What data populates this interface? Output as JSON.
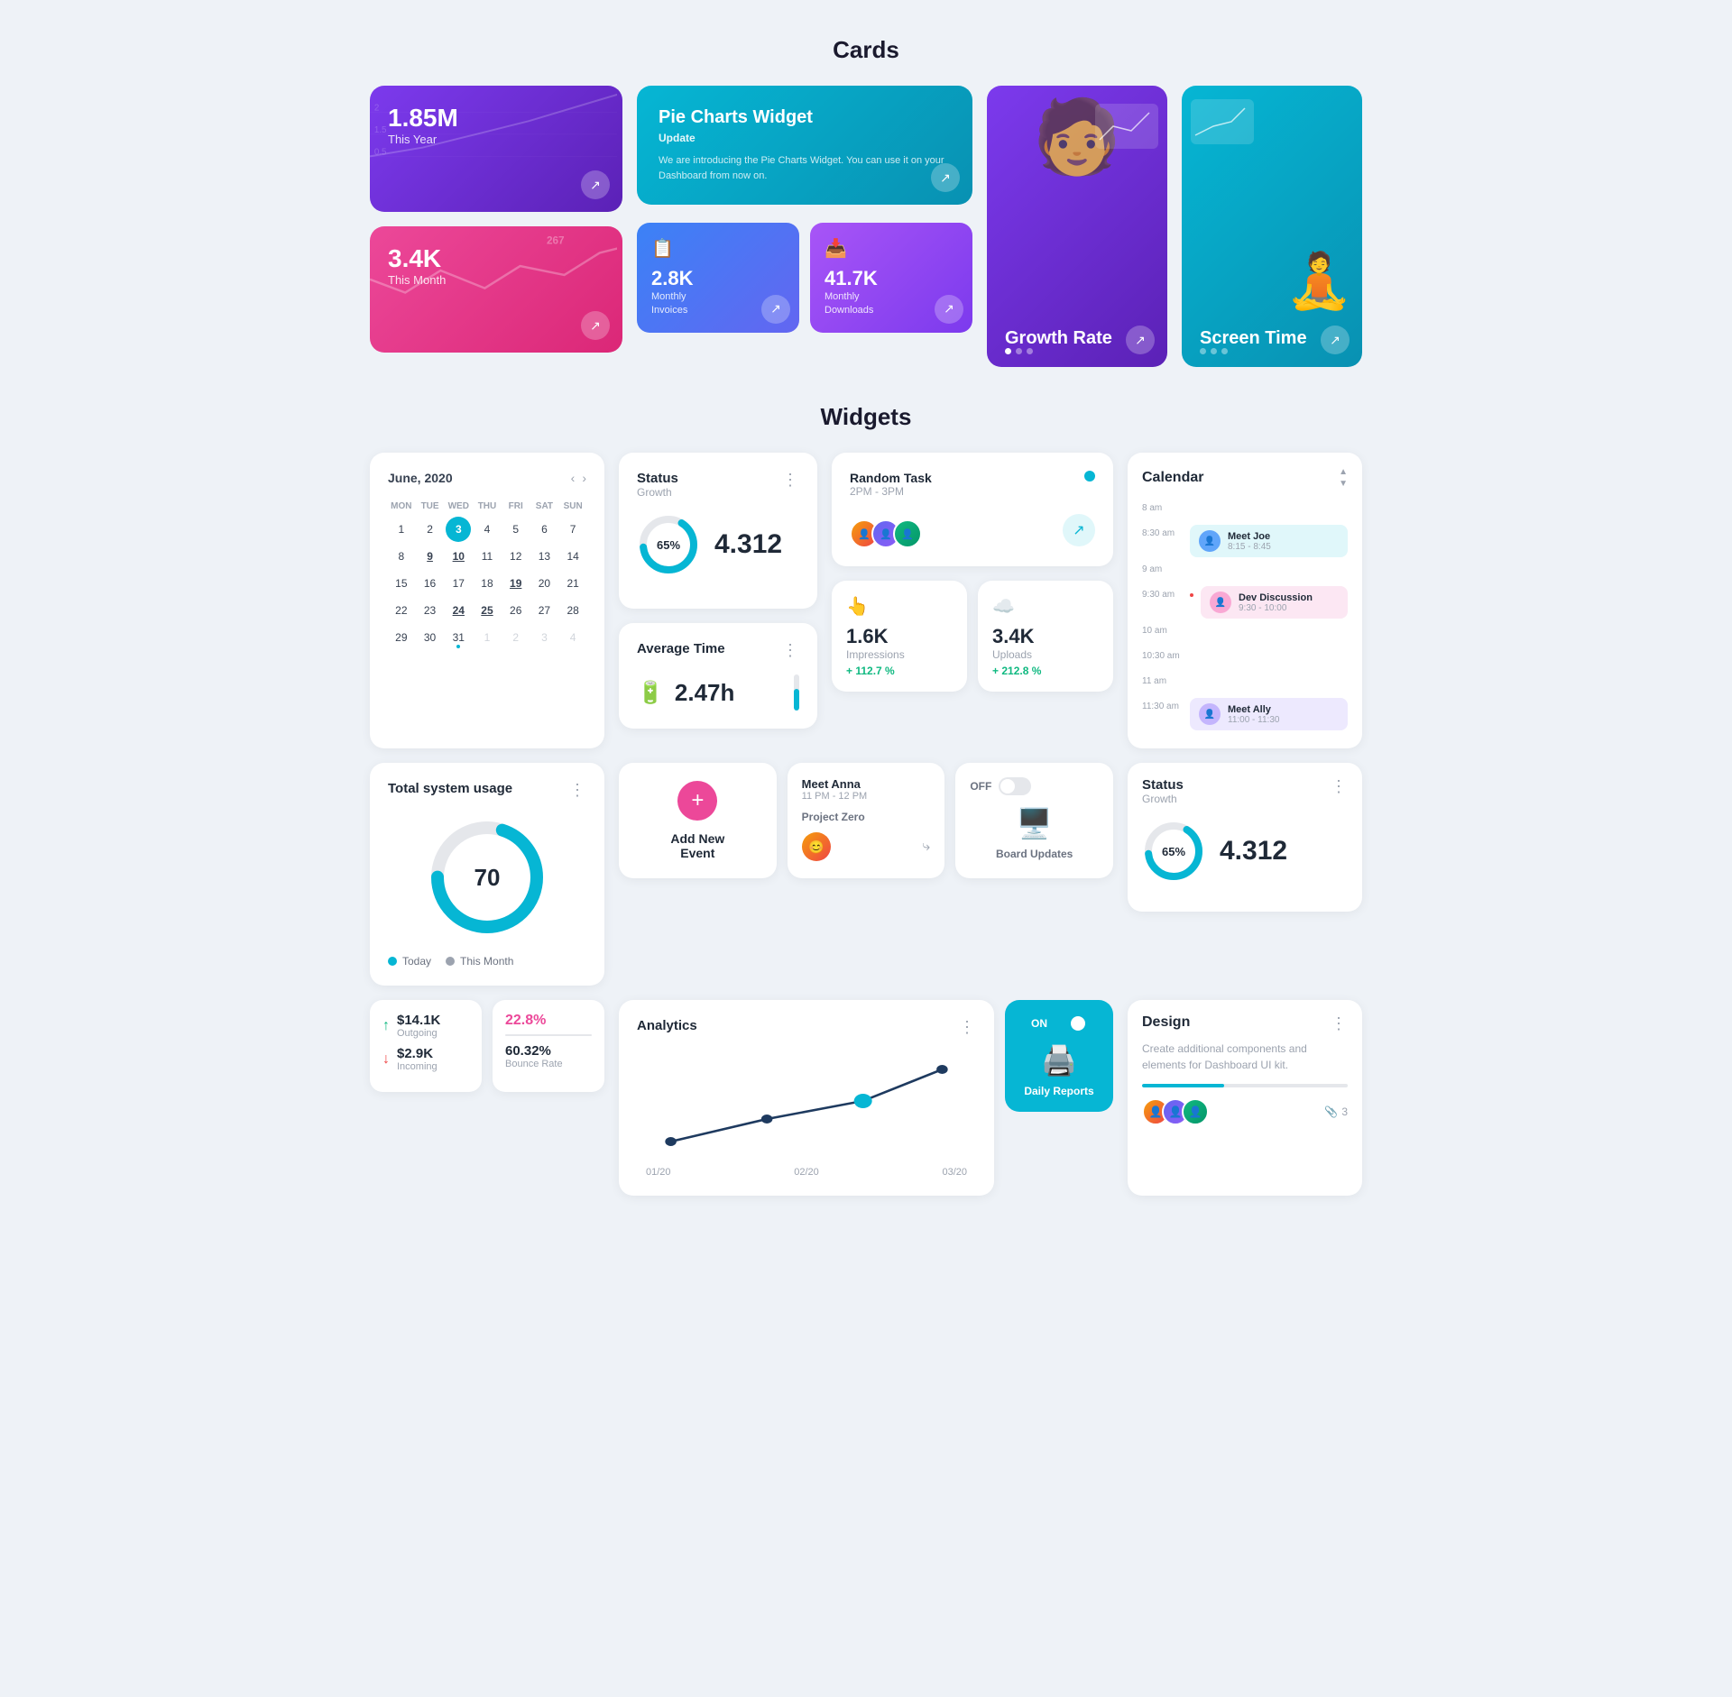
{
  "page": {
    "sections": {
      "cards_title": "Cards",
      "widgets_title": "Widgets"
    }
  },
  "cards": {
    "purple_card": {
      "value": "1.85M",
      "label": "This Year",
      "arrow": "↗"
    },
    "pink_card": {
      "value": "3.4K",
      "label": "This Month",
      "arrow": "↗"
    },
    "pie_widget": {
      "title": "Pie Charts Widget",
      "subtitle": "Update",
      "description": "We are introducing the Pie Charts Widget. You can use it on your Dashboard from now on.",
      "arrow": "↗"
    },
    "monthly_invoices": {
      "icon": "📋",
      "value": "2.8K",
      "label1": "Monthly",
      "label2": "Invoices",
      "arrow": "↗"
    },
    "monthly_downloads": {
      "icon": "📥",
      "value": "41.7K",
      "label1": "Monthly",
      "label2": "Downloads",
      "arrow": "↗"
    },
    "growth_rate": {
      "label": "Growth Rate",
      "dots": [
        "active",
        "",
        ""
      ],
      "arrow": "↗"
    },
    "screen_time": {
      "label": "Screen Time",
      "dots": [
        "",
        "",
        ""
      ],
      "arrow": "↗"
    }
  },
  "calendar_small": {
    "title": "June, 2020",
    "days_header": [
      "MON",
      "TUE",
      "WED",
      "THU",
      "FRI",
      "SAT",
      "SUN"
    ],
    "weeks": [
      [
        {
          "day": "1",
          "type": ""
        },
        {
          "day": "2",
          "type": ""
        },
        {
          "day": "3",
          "type": "today"
        },
        {
          "day": "4",
          "type": ""
        },
        {
          "day": "5",
          "type": ""
        },
        {
          "day": "6",
          "type": ""
        },
        {
          "day": "7",
          "type": ""
        }
      ],
      [
        {
          "day": "8",
          "type": ""
        },
        {
          "day": "9",
          "type": "underline"
        },
        {
          "day": "10",
          "type": "underline"
        },
        {
          "day": "11",
          "type": ""
        },
        {
          "day": "12",
          "type": ""
        },
        {
          "day": "13",
          "type": ""
        },
        {
          "day": "14",
          "type": ""
        }
      ],
      [
        {
          "day": "15",
          "type": ""
        },
        {
          "day": "16",
          "type": ""
        },
        {
          "day": "17",
          "type": ""
        },
        {
          "day": "18",
          "type": ""
        },
        {
          "day": "19",
          "type": "underline"
        },
        {
          "day": "20",
          "type": ""
        },
        {
          "day": "21",
          "type": ""
        }
      ],
      [
        {
          "day": "22",
          "type": ""
        },
        {
          "day": "23",
          "type": ""
        },
        {
          "day": "24",
          "type": "underline"
        },
        {
          "day": "25",
          "type": "underline"
        },
        {
          "day": "26",
          "type": ""
        },
        {
          "day": "27",
          "type": ""
        },
        {
          "day": "28",
          "type": ""
        }
      ],
      [
        {
          "day": "29",
          "type": ""
        },
        {
          "day": "30",
          "type": ""
        },
        {
          "day": "31",
          "type": "dot-mark"
        },
        {
          "day": "1",
          "type": "faded"
        },
        {
          "day": "2",
          "type": "faded"
        },
        {
          "day": "3",
          "type": "faded"
        },
        {
          "day": "4",
          "type": "faded"
        }
      ]
    ]
  },
  "status_widget": {
    "title": "Status",
    "subtitle": "Growth",
    "menu": "⋮",
    "percent": 65,
    "value": "4.312"
  },
  "avg_time_widget": {
    "title": "Average Time",
    "menu": "⋮",
    "value": "2.47h",
    "progress": 60
  },
  "random_task": {
    "title": "Random Task",
    "time": "2PM - 3PM",
    "status_dot": true,
    "avatars": [
      "👤",
      "👤",
      "👤"
    ],
    "arrow": "↗"
  },
  "impressions": {
    "icon": "👆",
    "value": "1.6K",
    "label": "Impressions",
    "change": "+ 112.7 %"
  },
  "uploads": {
    "icon": "☁️",
    "value": "3.4K",
    "label": "Uploads",
    "change": "+ 212.8 %"
  },
  "system_usage": {
    "title": "Total system usage",
    "menu": "⋮",
    "percent": 70,
    "legend": {
      "today": "Today",
      "this_month": "This Month"
    }
  },
  "add_event": {
    "plus": "+",
    "label1": "Add New",
    "label2": "Event"
  },
  "meet_anna": {
    "title": "Meet Anna",
    "time": "11 PM - 12 PM",
    "project": "Project Zero",
    "share_icon": "⟳"
  },
  "off_board": {
    "toggle_label": "OFF",
    "toggle_state": false,
    "icon": "🖥️",
    "label": "Board Updates"
  },
  "daily_reports": {
    "toggle_label": "ON",
    "toggle_state": true,
    "icon": "🖨️",
    "label": "Daily Reports"
  },
  "analytics": {
    "title": "Analytics",
    "menu": "⋮",
    "x_labels": [
      "01/20",
      "02/20",
      "03/20"
    ],
    "chart_points": [
      {
        "x": 10,
        "y": 80
      },
      {
        "x": 35,
        "y": 60
      },
      {
        "x": 60,
        "y": 50
      },
      {
        "x": 85,
        "y": 15
      }
    ]
  },
  "calendar_timeline": {
    "title": "Calendar",
    "events": [
      {
        "time": "8 am",
        "event": null
      },
      {
        "time": "8:30 am",
        "event": {
          "title": "Meet Joe",
          "time_range": "8:15 - 8:45",
          "color": "blue"
        }
      },
      {
        "time": "9 am",
        "event": null
      },
      {
        "time": "9:30 am",
        "event": {
          "title": "Dev Discussion",
          "time_range": "9:30 - 10:00",
          "color": "pink"
        },
        "indicator": true
      },
      {
        "time": "10 am",
        "event": null
      },
      {
        "time": "10:30 am",
        "event": null
      },
      {
        "time": "11 am",
        "event": null
      },
      {
        "time": "11:30 am",
        "event": {
          "title": "Meet Ally",
          "time_range": "11:00 - 11:30",
          "color": "purple"
        }
      }
    ]
  },
  "status_widget_sm": {
    "title": "Status",
    "subtitle": "Growth",
    "menu": "⋮",
    "percent": 65,
    "value": "4.312"
  },
  "finance": {
    "outgoing": {
      "arrow": "↑",
      "value": "$14.1K",
      "label": "Outgoing"
    },
    "incoming": {
      "arrow": "↓",
      "value": "$2.9K",
      "label": "Incoming"
    },
    "bounce_rate_label": "22.8%",
    "bounce_rate_text": "60.32%",
    "bounce_rate_sublabel": "Bounce Rate"
  },
  "design": {
    "title": "Design",
    "menu": "⋮",
    "description": "Create additional components and elements for Dashboard UI kit.",
    "progress": 40,
    "attach_count": "3"
  }
}
